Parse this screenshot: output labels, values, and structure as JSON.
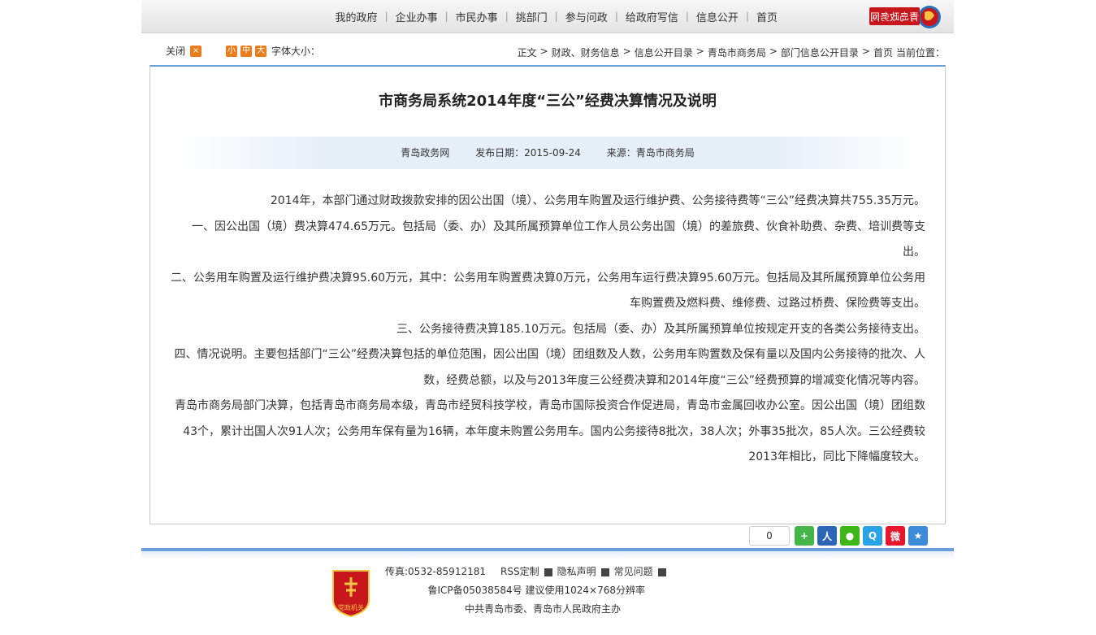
{
  "header": {
    "logo_text": "青岛政务网",
    "nav": [
      "首页",
      "信息公开",
      "给政府写信",
      "参与问政",
      "挑部门",
      "市民办事",
      "企业办事",
      "我的政府"
    ]
  },
  "breadcrumb": {
    "prefix": "当前位置：",
    "items": [
      "首页",
      "部门信息公开目录",
      "青岛市商务局",
      "信息公开目录",
      "财政、财务信息",
      "正文"
    ]
  },
  "font_size": {
    "label": "字体大小：",
    "large": "大",
    "medium": "中",
    "small": "小",
    "close": "关闭"
  },
  "article": {
    "title": "市商务局系统2014年度“三公”经费决算情况及说明",
    "source_site": "青岛政务网",
    "publish_date": "发布日期：2015-09-24",
    "source": "来源：青岛市商务局",
    "paragraphs": [
      "2014年，本部门通过财政拨款安排的因公出国（境）、公务用车购置及运行维护费、公务接待费等“三公”经费决算共755.35万元。",
      "一、因公出国（境）费决算474.65万元。包括局（委、办）及其所属预算单位工作人员公务出国（境）的差旅费、伙食补助费、杂费、培训费等支出。",
      "二、公务用车购置及运行维护费决算95.60万元，其中：公务用车购置费决算0万元，公务用车运行费决算95.60万元。包括局及其所属预算单位公务用车购置费及燃料费、维修费、过路过桥费、保险费等支出。",
      "三、公务接待费决算185.10万元。包括局（委、办）及其所属预算单位按规定开支的各类公务接待支出。",
      "四、情况说明。主要包括部门“三公”经费决算包括的单位范围，因公出国（境）团组数及人数，公务用车购置数及保有量以及国内公务接待的批次、人数，经费总额，以及与2013年度三公经费决算和2014年度“三公”经费预算的增减变化情况等内容。",
      "青岛市商务局部门决算，包括青岛市商务局本级，青岛市经贸科技学校，青岛市国际投资合作促进局，青岛市金属回收办公室。因公出国（境）团组数43个，累计出国人次91人次；公务用车保有量为16辆，本年度未购置公务用车。国内公务接待8批次，38人次；外事35批次，85人次。三公经费较2013年相比，同比下降幅度较大。"
    ]
  },
  "share": {
    "count": "0",
    "icons": [
      "qzone-star-icon",
      "weibo-icon",
      "qq-icon",
      "wechat-icon",
      "renren-icon",
      "more-plus-icon"
    ]
  },
  "footer": {
    "links": [
      "常见问题",
      "隐私声明",
      "RSS定制"
    ],
    "fax": "传真:0532-85912181",
    "icp": "鲁ICP备05038584号  建议使用1024×768分辨率",
    "host": "中共青岛市委、青岛市人民政府主办",
    "emblem_text": "党政机关"
  },
  "colors": {
    "accent_orange": "#e87d1e",
    "blue_line": "#6a9fd8",
    "logo_red": "#c8161d"
  }
}
